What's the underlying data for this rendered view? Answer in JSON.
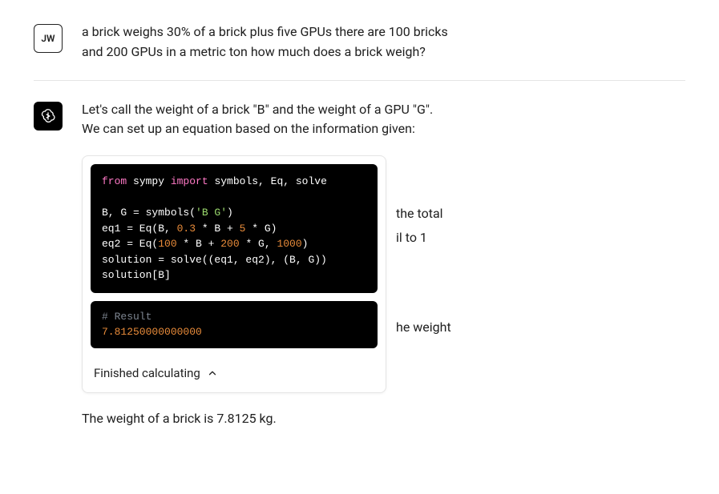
{
  "user": {
    "avatar_initials": "JW",
    "message": "a brick weighs 30% of a brick plus five GPUs there are 100 bricks and 200 GPUs in a metric ton how much does a brick weigh?"
  },
  "assistant": {
    "intro": "Let's call the weight of a brick \"B\" and the weight of a GPU \"G\". We can set up an equation based on the information given:",
    "behind_frag_1": "the total",
    "behind_frag_2": "il to 1",
    "behind_frag_3": "he weight",
    "code": {
      "l1_from": "from",
      "l1_mod": " sympy ",
      "l1_import": "import",
      "l1_rest": " symbols, Eq, solve",
      "l2_a": "B, G = symbols(",
      "l2_str": "'B G'",
      "l2_b": ")",
      "l3_a": "eq1 = Eq(B, ",
      "l3_n1": "0.3",
      "l3_b": " * B + ",
      "l3_n2": "5",
      "l3_c": " * G)",
      "l4_a": "eq2 = Eq(",
      "l4_n1": "100",
      "l4_b": " * B + ",
      "l4_n2": "200",
      "l4_c": " * G, ",
      "l4_n3": "1000",
      "l4_d": ")",
      "l5": "solution = solve((eq1, eq2), (B, G))",
      "l6": "solution[B]"
    },
    "result": {
      "comment": "# Result",
      "value": "7.81250000000000"
    },
    "status_label": "Finished calculating",
    "final": "The weight of a brick is 7.8125 kg."
  }
}
